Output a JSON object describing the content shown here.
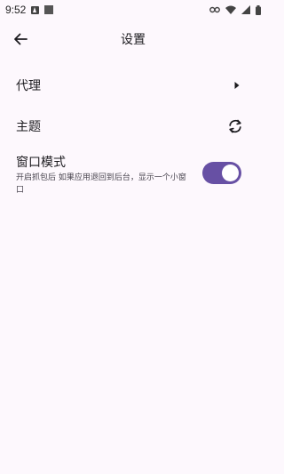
{
  "status_bar": {
    "time": "9:52",
    "icons": [
      "notification-a-icon",
      "notification-square-icon",
      "link-icon",
      "wifi-icon",
      "signal-icon",
      "battery-icon"
    ]
  },
  "app_bar": {
    "title": "设置",
    "back_icon": "arrow-back-icon"
  },
  "settings": {
    "proxy": {
      "label": "代理",
      "icon": "chevron-right-icon"
    },
    "theme": {
      "label": "主题",
      "icon": "sync-icon"
    },
    "window_mode": {
      "label": "窗口模式",
      "description": "开启抓包后 如果应用退回到后台，显示一个小窗口",
      "enabled": true
    }
  },
  "colors": {
    "background": "#fdf8fd",
    "accent": "#6750a4"
  }
}
